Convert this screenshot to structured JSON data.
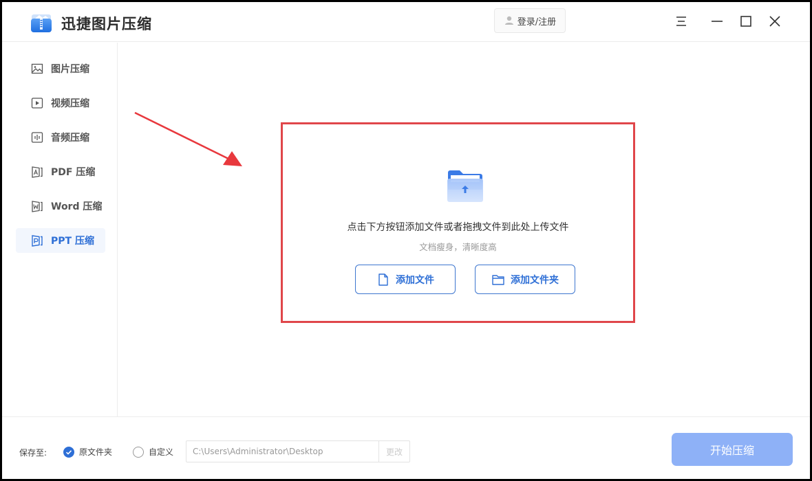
{
  "app": {
    "title": "迅捷图片压缩",
    "login_label": "登录/注册"
  },
  "window_controls": {
    "menu": "menu-icon",
    "minimize": "minimize-icon",
    "maximize": "maximize-icon",
    "close": "close-icon"
  },
  "sidebar": {
    "items": [
      {
        "label": "图片压缩",
        "icon": "image-icon",
        "active": false
      },
      {
        "label": "视频压缩",
        "icon": "video-icon",
        "active": false
      },
      {
        "label": "音频压缩",
        "icon": "audio-icon",
        "active": false
      },
      {
        "label": "PDF 压缩",
        "icon": "pdf-icon",
        "active": false
      },
      {
        "label": "Word 压缩",
        "icon": "word-icon",
        "active": false
      },
      {
        "label": "PPT 压缩",
        "icon": "ppt-icon",
        "active": true
      }
    ]
  },
  "dropzone": {
    "main_text": "点击下方按钮添加文件或者拖拽文件到此处上传文件",
    "sub_text": "文档瘦身，清晰度高",
    "add_file_label": "添加文件",
    "add_folder_label": "添加文件夹"
  },
  "footer": {
    "save_to_label": "保存至:",
    "option_original": "原文件夹",
    "option_custom": "自定义",
    "selected_option": "原文件夹",
    "path_value": "C:\\Users\\Administrator\\Desktop",
    "change_label": "更改",
    "start_label": "开始压缩"
  },
  "colors": {
    "accent": "#2e6fd6",
    "start_button": "#8eb1f7",
    "highlight_border": "#e0464a",
    "active_nav_bg": "#f2f6fd"
  }
}
